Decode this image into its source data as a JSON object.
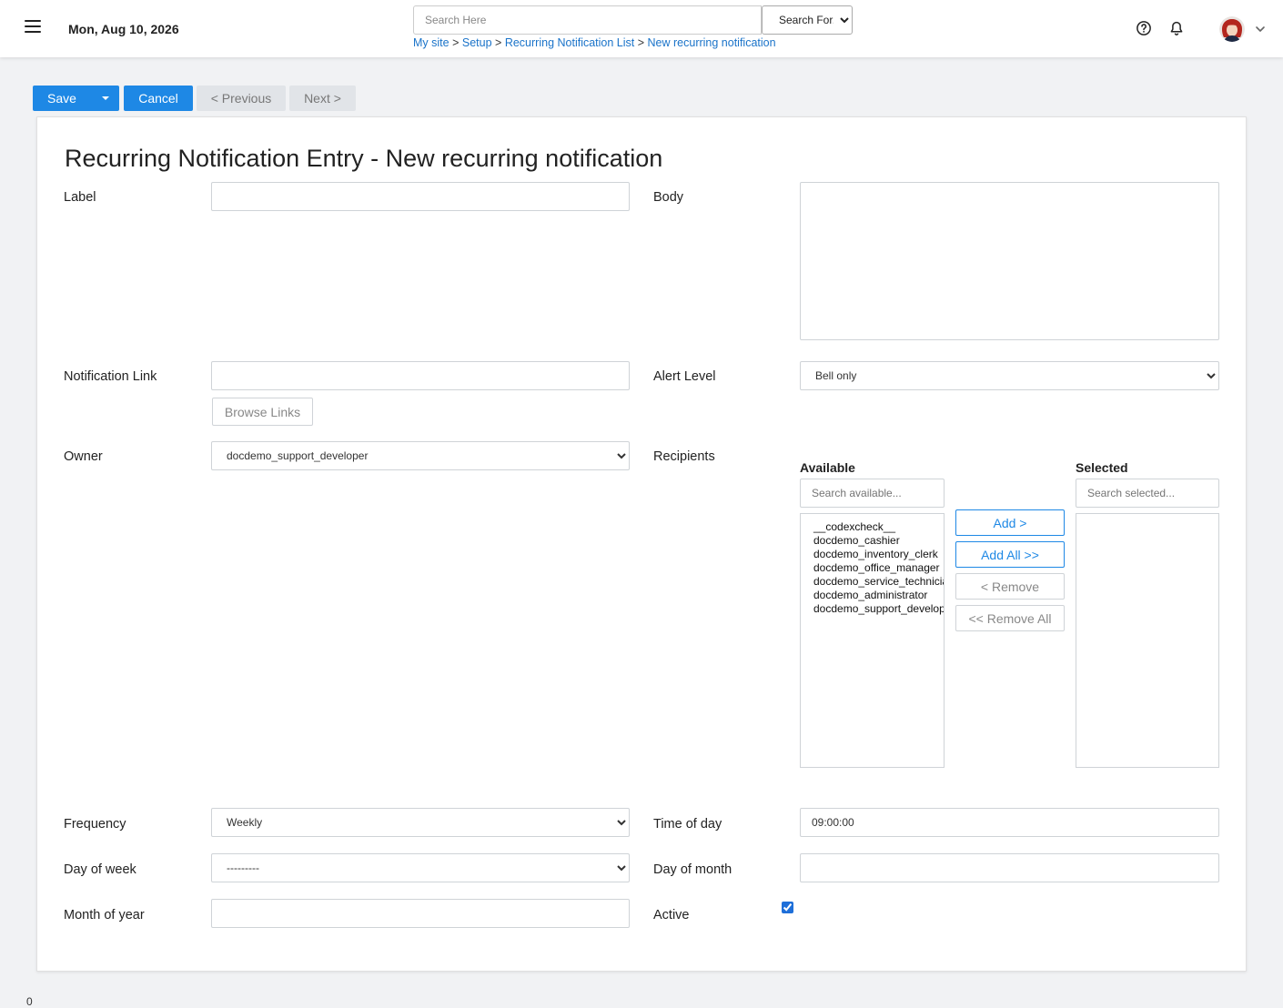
{
  "header": {
    "date": "Mon, Aug 10, 2026",
    "search_placeholder": "Search Here",
    "search_scope": "Search For...",
    "breadcrumb": [
      {
        "label": "My site"
      },
      {
        "label": "Setup"
      },
      {
        "label": "Recurring Notification List"
      },
      {
        "label": "New recurring notification"
      }
    ],
    "breadcrumb_separator": ">"
  },
  "toolbar": {
    "save_label": "Save",
    "cancel_label": "Cancel",
    "previous_label": "< Previous",
    "next_label": "Next >"
  },
  "form": {
    "title": "Recurring Notification Entry - New recurring notification",
    "label_label": "Label",
    "label_value": "",
    "body_label": "Body",
    "body_value": "",
    "notification_link_label": "Notification Link",
    "notification_link_value": "",
    "browse_links_label": "Browse Links",
    "alert_level_label": "Alert Level",
    "alert_level_value": "Bell only",
    "owner_label": "Owner",
    "owner_value": "docdemo_support_developer",
    "recipients_label": "Recipients",
    "frequency_label": "Frequency",
    "frequency_value": "Weekly",
    "time_of_day_label": "Time of day",
    "time_of_day_value": "09:00:00",
    "day_of_week_label": "Day of week",
    "day_of_week_value": "---------",
    "day_of_month_label": "Day of month",
    "day_of_month_value": "",
    "month_of_year_label": "Month of year",
    "month_of_year_value": "",
    "active_label": "Active",
    "active_checked": true
  },
  "recipients": {
    "available_heading": "Available",
    "selected_heading": "Selected",
    "available_search_placeholder": "Search available...",
    "selected_search_placeholder": "Search selected...",
    "available_items": [
      "__codexcheck__",
      "docdemo_cashier",
      "docdemo_inventory_clerk",
      "docdemo_office_manager",
      "docdemo_service_technician",
      "docdemo_administrator",
      "docdemo_support_developer"
    ],
    "selected_items": [],
    "add_label": "Add >",
    "add_all_label": "Add All >>",
    "remove_label": "< Remove",
    "remove_all_label": "<< Remove All"
  },
  "footer": {
    "mark": "0"
  },
  "colors": {
    "primary": "#1e88e5",
    "link": "#1a73c9",
    "page_bg": "#f1f2f4"
  }
}
